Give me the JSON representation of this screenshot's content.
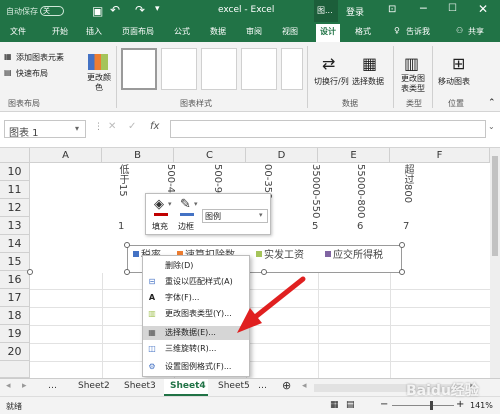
{
  "title_bar": {
    "autosave_label": "自动保存",
    "autosave_state": "关",
    "document_title": "excel - Excel",
    "context_label": "图...",
    "login_label": "登录"
  },
  "tabs": [
    "文件",
    "开始",
    "插入",
    "页面布局",
    "公式",
    "数据",
    "审阅",
    "视图",
    "设计",
    "格式"
  ],
  "active_tab": "设计",
  "tell_me": "告诉我",
  "share": "共享",
  "ribbon": {
    "add_chart_element": "添加图表元素",
    "quick_layout": "快速布局",
    "change_colors": "更改颜色",
    "group_chart_layout": "图表布局",
    "group_chart_styles": "图表样式",
    "switch_row_col": "切换行/列",
    "select_data": "选择数据",
    "group_data": "数据",
    "change_chart_type": "更改图表类型",
    "group_type": "类型",
    "move_chart": "移动图表",
    "group_location": "位置"
  },
  "formula_bar": {
    "name_box": "图表 1",
    "fx": "fx"
  },
  "columns": [
    "A",
    "B",
    "C",
    "D",
    "E",
    "F"
  ],
  "rows": [
    "10",
    "11",
    "12",
    "13",
    "14",
    "15",
    "16",
    "17",
    "18",
    "19",
    "20"
  ],
  "chart_labels": {
    "cat1": "低于15",
    "cat2": "500-45",
    "cat3": "500-90",
    "cat4": "00-350",
    "cat5": "35000-550",
    "cat6": "55000-800",
    "cat7": "超过800",
    "num1": "1",
    "num3": "3",
    "num5": "5",
    "num6": "6",
    "num7": "7"
  },
  "legend": {
    "item1": "税率",
    "item2": "速算扣除数",
    "item3": "实发工资",
    "item4": "应交所得税"
  },
  "mini_toolbar": {
    "fill_label": "填充",
    "outline_label": "边框",
    "dropdown_value": "图例"
  },
  "context_menu": [
    {
      "label": "删除(D)",
      "icon": "blank"
    },
    {
      "label": "重设以匹配样式(A)",
      "icon": "reset-icon"
    },
    {
      "label": "字体(F)...",
      "icon": "font-icon"
    },
    {
      "label": "更改图表类型(Y)...",
      "icon": "chart-type-icon"
    },
    {
      "label": "选择数据(E)...",
      "icon": "select-data-icon"
    },
    {
      "label": "三维旋转(R)...",
      "icon": "rotate-3d-icon"
    },
    {
      "label": "设置图例格式(F)...",
      "icon": "format-legend-icon"
    }
  ],
  "highlighted_menu_item": "选择数据(E)...",
  "sheet_tabs": [
    "Sheet2",
    "Sheet3",
    "Sheet4",
    "Sheet5"
  ],
  "active_sheet": "Sheet4",
  "status": {
    "left": "就绪",
    "zoom": "141%"
  },
  "watermark": "Baidu经验",
  "colors": {
    "excel_green": "#217346",
    "arrow_red": "#e02020",
    "legend_blue": "#4472c4",
    "legend_orange": "#ed7d31",
    "legend_green": "#a5c45a",
    "legend_purple": "#8064a2"
  }
}
